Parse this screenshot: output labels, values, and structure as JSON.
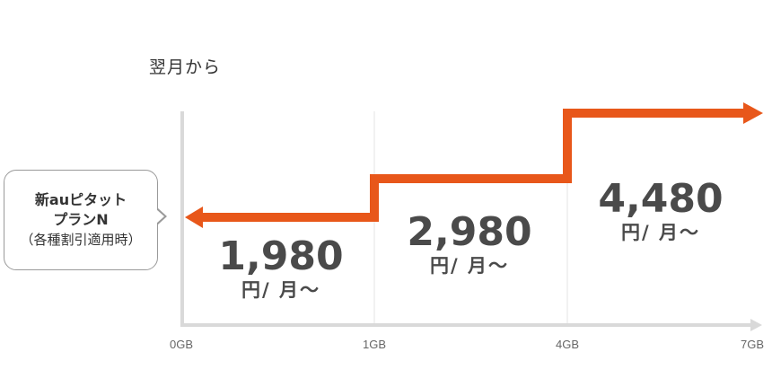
{
  "heading": "翌月から",
  "callout": {
    "line1": "新auピタット",
    "line2": "プランN",
    "line3": "（各種割引適用時）"
  },
  "prices": [
    {
      "amount": "1,980",
      "unit": "円/ 月～"
    },
    {
      "amount": "2,980",
      "unit": "円/ 月～"
    },
    {
      "amount": "4,480",
      "unit": "円/ 月～"
    }
  ],
  "chart_data": {
    "type": "line",
    "step": true,
    "x_ticks": [
      "0GB",
      "1GB",
      "4GB",
      "7GB"
    ],
    "x_tick_values": [
      0,
      1,
      4,
      7
    ],
    "segments": [
      {
        "from": 0,
        "to": 1,
        "value": 1980
      },
      {
        "from": 1,
        "to": 4,
        "value": 2980
      },
      {
        "from": 4,
        "to": 7,
        "value": 4480
      }
    ],
    "colors": {
      "line": "#e8571a",
      "axis": "#d9d9d9",
      "grid": "#e3e3e3",
      "tick_text": "#666666"
    }
  }
}
